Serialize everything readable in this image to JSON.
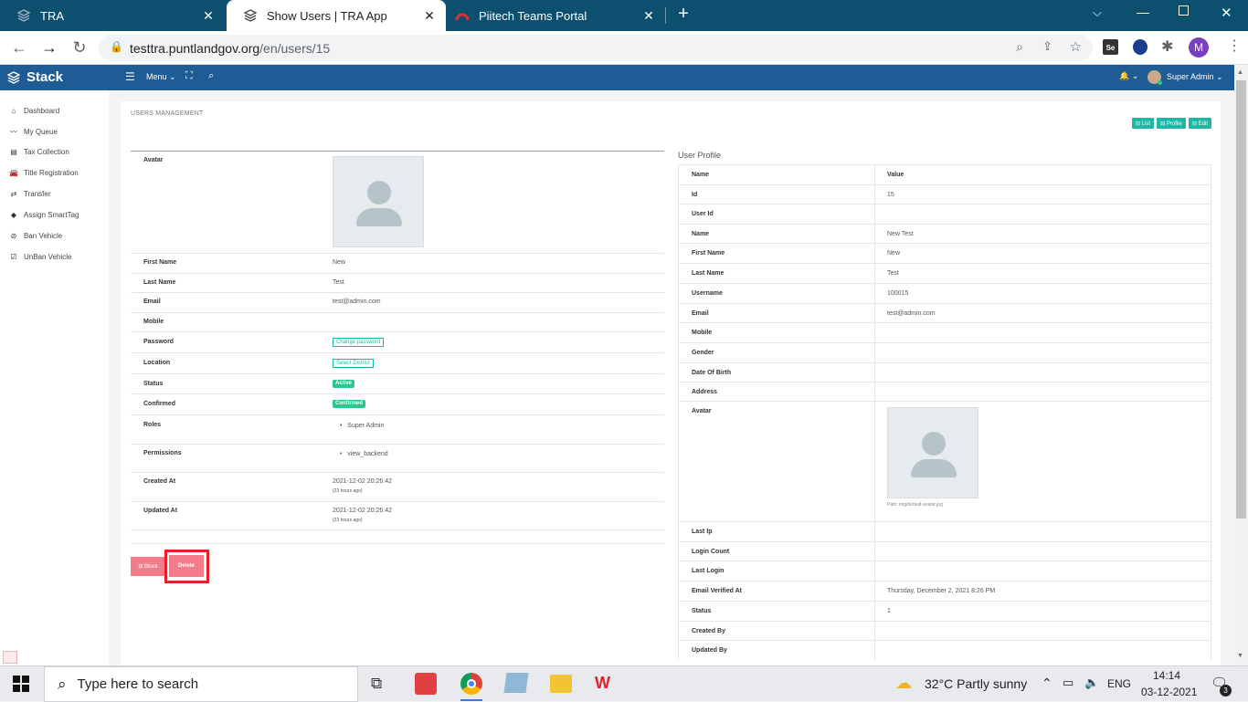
{
  "browser": {
    "tabs": [
      {
        "title": "TRA",
        "active": false
      },
      {
        "title": "Show Users | TRA App",
        "active": true
      },
      {
        "title": "Piitech Teams Portal",
        "active": false
      }
    ],
    "url_host": "testtra.puntlandgov.org",
    "url_path": "/en/users/15",
    "profile_initial": "M",
    "ext_label": "Se"
  },
  "app": {
    "brand": "Stack",
    "menu_label": "Menu",
    "user_name": "Super Admin"
  },
  "sidebar": {
    "items": [
      {
        "label": "Dashboard",
        "icon": "home-icon"
      },
      {
        "label": "My Queue",
        "icon": "trend-icon"
      },
      {
        "label": "Tax Collection",
        "icon": "register-icon"
      },
      {
        "label": "Title Registration",
        "icon": "car-icon"
      },
      {
        "label": "Transfer",
        "icon": "transfer-icon"
      },
      {
        "label": "Assign SmartTag",
        "icon": "tag-icon"
      },
      {
        "label": "Ban Vehicle",
        "icon": "ban-icon"
      },
      {
        "label": "UnBan Vehicle",
        "icon": "check-square-icon"
      }
    ]
  },
  "content": {
    "breadcrumb": "USERS MANAGEMENT",
    "top_buttons": {
      "list": "⊟ List",
      "profile": "⊟ Profile",
      "edit": "⊟ Edit"
    },
    "left_table": {
      "avatar_label": "Avatar",
      "first_name_label": "First Name",
      "first_name": "New",
      "last_name_label": "Last Name",
      "last_name": "Test",
      "email_label": "Email",
      "email": "test@admin.com",
      "mobile_label": "Mobile",
      "password_label": "Password",
      "password_btn": "Change password",
      "location_label": "Location",
      "location_btn": "Select District",
      "status_label": "Status",
      "status_badge": "Active",
      "confirmed_label": "Confirmed",
      "confirmed_badge": "Confirmed",
      "roles_label": "Roles",
      "role": "Super Admin",
      "permissions_label": "Permissions",
      "permission": "view_backend",
      "created_label": "Created At",
      "created": "2021-12-02 20:26:42",
      "created_ago": "(23 hours ago)",
      "updated_label": "Updated At",
      "updated": "2021-12-02 20:26:42",
      "updated_ago": "(23 hours ago)"
    },
    "actions": {
      "block": "⊟ Block",
      "delete": "Delete"
    },
    "profile": {
      "heading": "User Profile",
      "header": {
        "name": "Name",
        "value": "Value"
      },
      "rows": [
        {
          "name": "Id",
          "value": "15"
        },
        {
          "name": "User Id",
          "value": ""
        },
        {
          "name": "Name",
          "value": "New Test"
        },
        {
          "name": "First Name",
          "value": "New"
        },
        {
          "name": "Last Name",
          "value": "Test"
        },
        {
          "name": "Username",
          "value": "100015"
        },
        {
          "name": "Email",
          "value": "test@admin.com"
        },
        {
          "name": "Mobile",
          "value": ""
        },
        {
          "name": "Gender",
          "value": ""
        },
        {
          "name": "Date Of Birth",
          "value": ""
        },
        {
          "name": "Address",
          "value": ""
        }
      ],
      "avatar_label": "Avatar",
      "avatar_path": "Path: img/default-avatar.jpg",
      "rows2": [
        {
          "name": "Last Ip",
          "value": ""
        },
        {
          "name": "Login Count",
          "value": ""
        },
        {
          "name": "Last Login",
          "value": ""
        },
        {
          "name": "Email Verified At",
          "value": "Thursday, December 2, 2021 8:26 PM"
        },
        {
          "name": "Status",
          "value": "1"
        },
        {
          "name": "Created By",
          "value": ""
        },
        {
          "name": "Updated By",
          "value": ""
        }
      ]
    }
  },
  "taskbar": {
    "search_placeholder": "Type here to search",
    "weather": "32°C  Partly sunny",
    "lang": "ENG",
    "time": "14:14",
    "date": "03-12-2021",
    "notifications": "3"
  }
}
